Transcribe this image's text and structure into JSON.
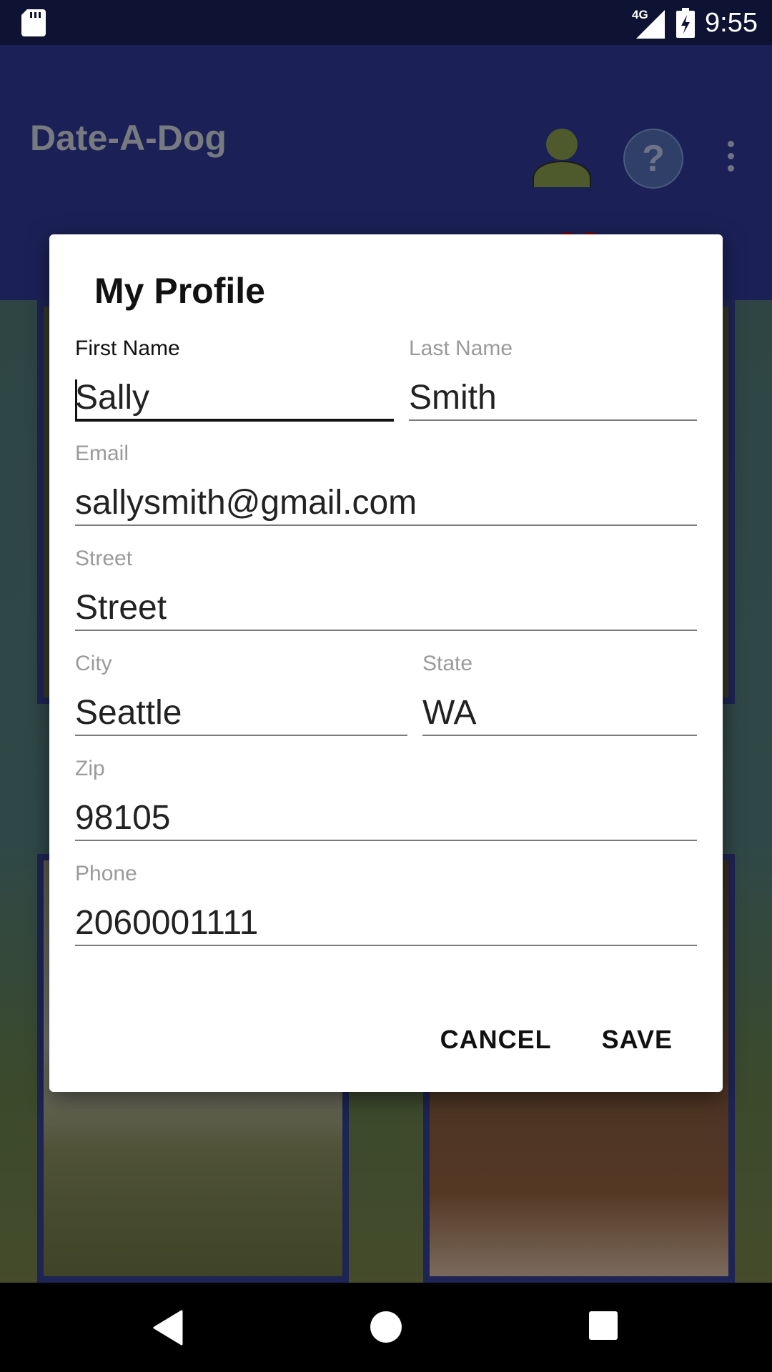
{
  "status_bar": {
    "time": "9:55",
    "network_label": "4G",
    "icons": [
      "sd-card-icon",
      "cellular-signal-icon",
      "battery-charging-icon"
    ]
  },
  "app_bar": {
    "title": "Date-A-Dog",
    "help_label": "?",
    "icons": [
      "profile-icon",
      "help-icon",
      "overflow-menu-icon"
    ]
  },
  "tabs": [
    {
      "icon": "dog-icon",
      "color": "#6b3e12"
    },
    {
      "icon": "heart-icon",
      "color": "#7a0000"
    }
  ],
  "dialog": {
    "title": "My Profile",
    "fields": {
      "first_name": {
        "label": "First Name",
        "value": "Sally"
      },
      "last_name": {
        "label": "Last Name",
        "value": "Smith"
      },
      "email": {
        "label": "Email",
        "value": "sallysmith@gmail.com"
      },
      "street": {
        "label": "Street",
        "value": "Street"
      },
      "city": {
        "label": "City",
        "value": "Seattle"
      },
      "state": {
        "label": "State",
        "value": "WA"
      },
      "zip": {
        "label": "Zip",
        "value": "98105"
      },
      "phone": {
        "label": "Phone",
        "value": "2060001111"
      }
    },
    "actions": {
      "cancel": "CANCEL",
      "save": "SAVE"
    }
  },
  "nav_bar": {
    "icons": [
      "back-icon",
      "home-icon",
      "recents-icon"
    ]
  },
  "colors": {
    "status_bar": "#0e1334",
    "app_bar": "#1b2157",
    "dialog": "#ffffff",
    "active_field": "#111111"
  }
}
